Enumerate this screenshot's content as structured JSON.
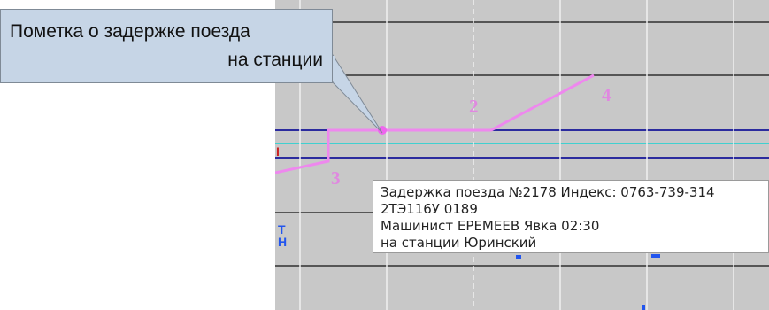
{
  "callout": {
    "line1": "Пометка о задержке поезда",
    "line2": "на станции"
  },
  "graph": {
    "segment_labels": [
      "2",
      "3",
      "4"
    ],
    "colors": {
      "background": "#c8c8c8",
      "train_line": "#ee88ee",
      "station_line_blue": "#2b2b9e",
      "station_line_cyan": "#40d0d0",
      "grid_dark": "#303030",
      "grid_light": "#f0f0f0"
    }
  },
  "tooltip": {
    "line1": "Задержка поезда №2178 Индекс: 0763-739-314",
    "line2": "2ТЭ116У 0189",
    "line3": "Машинист ЕРЕМЕЕВ  Явка  02:30",
    "line4": "на станции Юринский"
  }
}
